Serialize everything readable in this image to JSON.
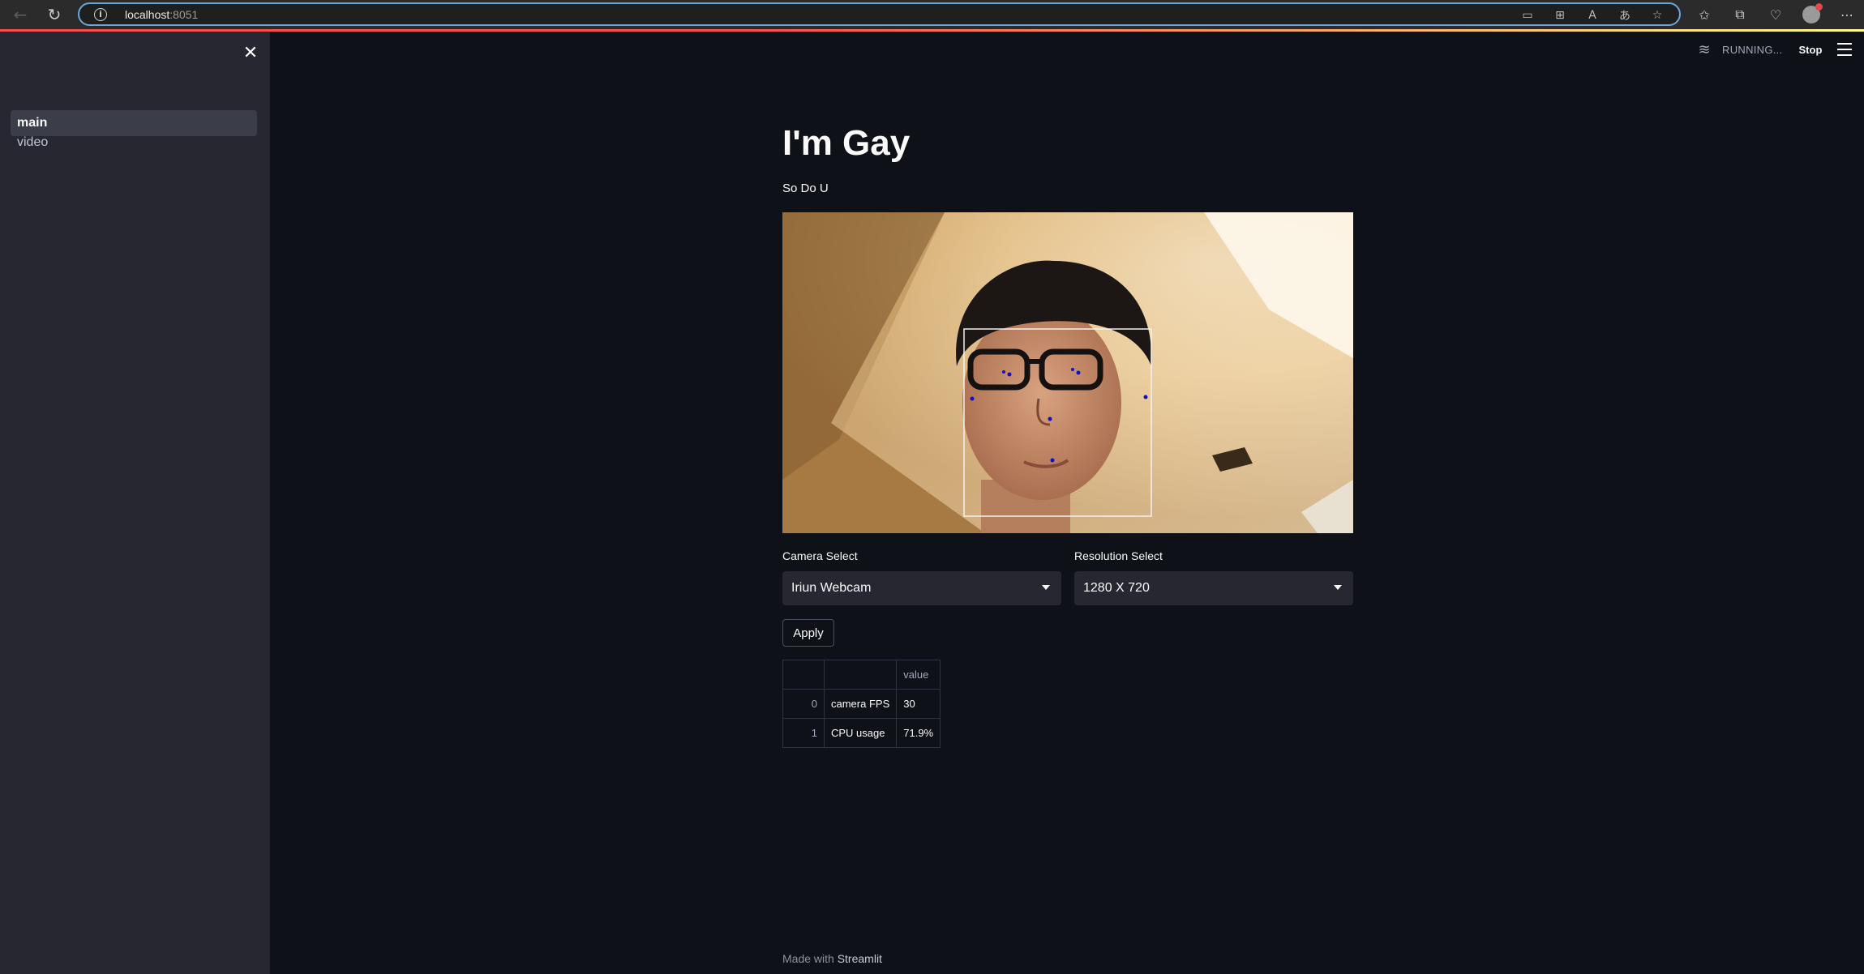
{
  "browser": {
    "url_host": "localhost",
    "url_port": ":8051"
  },
  "sidebar": {
    "items": [
      {
        "label": "main",
        "active": true
      },
      {
        "label": "video",
        "active": false
      }
    ]
  },
  "status": {
    "running_text": "RUNNING...",
    "stop_label": "Stop"
  },
  "main": {
    "title": "I'm Gay",
    "subtitle": "So Do U",
    "camera_label": "Camera Select",
    "camera_value": "Iriun Webcam",
    "resolution_label": "Resolution Select",
    "resolution_value": "1280 X 720",
    "apply_label": "Apply",
    "table": {
      "header": [
        "",
        "",
        "value"
      ],
      "rows": [
        {
          "index": "0",
          "name": "camera FPS",
          "value": "30"
        },
        {
          "index": "1",
          "name": "CPU usage",
          "value": "71.9%"
        }
      ]
    }
  },
  "footer": {
    "prefix": "Made with",
    "brand": "Streamlit"
  },
  "colors": {
    "background": "#0e1117",
    "sidebar": "#262730",
    "accent": "#ff4b4b",
    "text": "#fafafa"
  }
}
